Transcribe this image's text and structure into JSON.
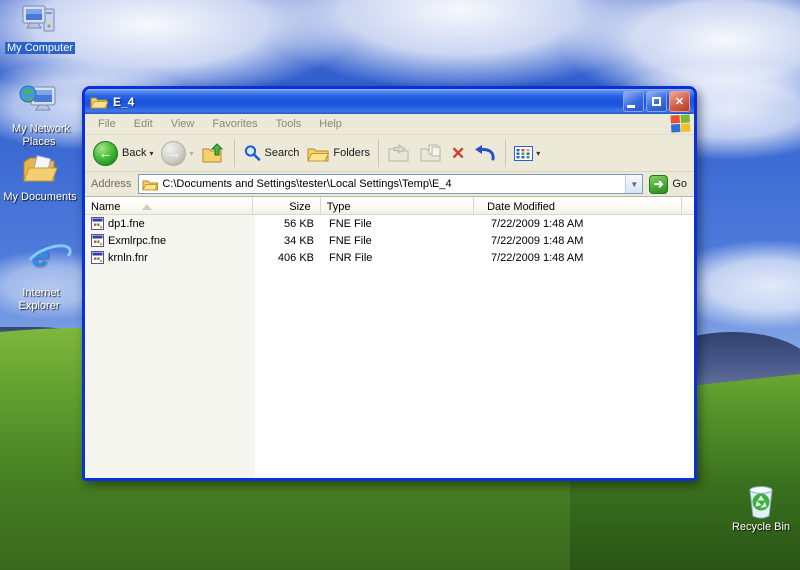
{
  "desktop": {
    "icons": [
      {
        "id": "my-computer",
        "label": "My Computer"
      },
      {
        "id": "my-network-places",
        "label": "My Network Places"
      },
      {
        "id": "my-documents",
        "label": "My Documents"
      },
      {
        "id": "internet-explorer",
        "label": "Internet Explorer"
      },
      {
        "id": "recycle-bin",
        "label": "Recycle Bin"
      }
    ]
  },
  "window": {
    "title": "E_4",
    "titlebar_buttons": {
      "minimize": "minimize",
      "maximize": "maximize",
      "close": "close"
    },
    "menu": [
      "File",
      "Edit",
      "View",
      "Favorites",
      "Tools",
      "Help"
    ],
    "toolbar": {
      "back_label": "Back",
      "search_label": "Search",
      "folders_label": "Folders"
    },
    "address": {
      "label": "Address",
      "value": "C:\\Documents and Settings\\tester\\Local Settings\\Temp\\E_4",
      "go_label": "Go"
    },
    "columns": [
      "Name",
      "Size",
      "Type",
      "Date Modified"
    ],
    "files": [
      {
        "name": "dp1.fne",
        "size": "56 KB",
        "type": "FNE File",
        "modified": "7/22/2009 1:48 AM"
      },
      {
        "name": "Exmlrpc.fne",
        "size": "34 KB",
        "type": "FNE File",
        "modified": "7/22/2009 1:48 AM"
      },
      {
        "name": "krnln.fnr",
        "size": "406 KB",
        "type": "FNR File",
        "modified": "7/22/2009 1:48 AM"
      }
    ],
    "colors": {
      "titlebar_blue": "#1952dc",
      "window_border": "#0831d9",
      "chrome_beige": "#ece9d8",
      "selection_blue": "#2a62c8",
      "delete_red": "#d23b27",
      "go_green": "#47ab35"
    }
  }
}
